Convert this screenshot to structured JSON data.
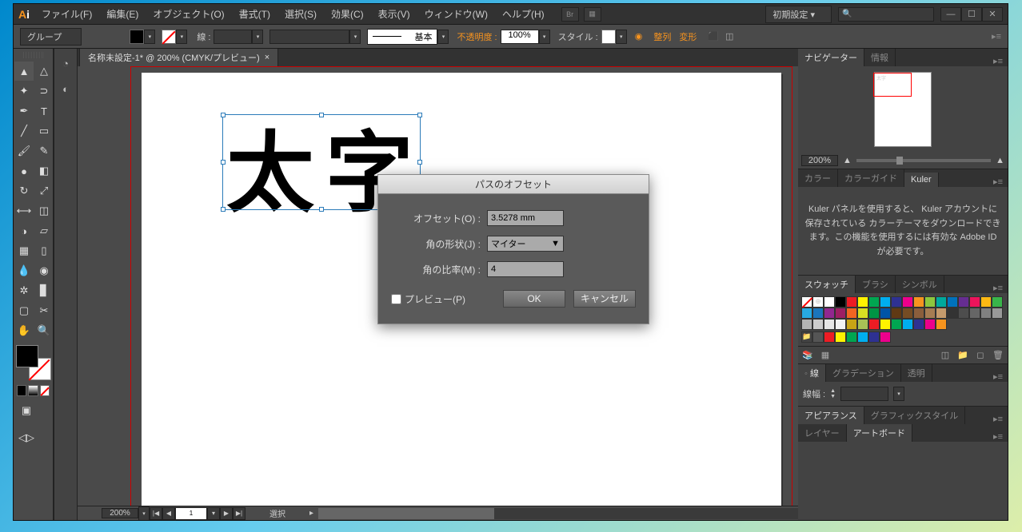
{
  "app_logo": "Ai",
  "menu": [
    "ファイル(F)",
    "編集(E)",
    "オブジェクト(O)",
    "書式(T)",
    "選択(S)",
    "効果(C)",
    "表示(V)",
    "ウィンドウ(W)",
    "ヘルプ(H)"
  ],
  "workspace": "初期設定",
  "control": {
    "selection_label": "グループ",
    "stroke_label": "線 :",
    "style_label": "基本",
    "opacity_label": "不透明度 :",
    "opacity_value": "100%",
    "style2_label": "スタイル :",
    "align_label": "整列",
    "transform_label": "変形"
  },
  "doc_tab": "名称未設定-1* @ 200% (CMYK/プレビュー)",
  "canvas_text": "太字",
  "doc_status": {
    "zoom": "200%",
    "page": "1",
    "mode": "選択"
  },
  "panels": {
    "navigator": {
      "tabs": [
        "ナビゲーター",
        "情報"
      ],
      "zoom": "200%",
      "thumb_text": "太字"
    },
    "color": {
      "tabs": [
        "カラー",
        "カラーガイド",
        "Kuler"
      ],
      "kuler_msg": "Kuler パネルを使用すると、\nKuler アカウントに保存されている\nカラーテーマをダウンロードできます。この機能を使用するには有効な Adobe ID が必要です。"
    },
    "swatches": {
      "tabs": [
        "スウォッチ",
        "ブラシ",
        "シンボル"
      ]
    },
    "stroke": {
      "tabs": [
        "線",
        "グラデーション",
        "透明"
      ],
      "label": "線幅 :"
    },
    "appearance": {
      "tabs": [
        "アピアランス",
        "グラフィックスタイル"
      ]
    },
    "layers": {
      "tabs": [
        "レイヤー",
        "アートボード"
      ]
    }
  },
  "dialog": {
    "title": "パスのオフセット",
    "offset_label": "オフセット(O) :",
    "offset_value": "3.5278 mm",
    "join_label": "角の形状(J) :",
    "join_value": "マイター",
    "miter_label": "角の比率(M) :",
    "miter_value": "4",
    "preview_label": "プレビュー(P)",
    "ok": "OK",
    "cancel": "キャンセル"
  },
  "swatch_colors": [
    "#ffffff",
    "#000000",
    "#ed1c24",
    "#fff200",
    "#00a651",
    "#00aeef",
    "#2e3192",
    "#ec008c",
    "#f7941e",
    "#8dc63e",
    "#00a99d",
    "#0072bc",
    "#662d91",
    "#ed145b",
    "#fdb913",
    "#39b54a",
    "#27aae1",
    "#1b75bb",
    "#92278f",
    "#9e1f63",
    "#f26522",
    "#d7df23",
    "#009444",
    "#0054a6",
    "#603913",
    "#754c24",
    "#8b5e3c",
    "#a67c52",
    "#c49a6c",
    "#333333",
    "#4d4d4d",
    "#666666",
    "#808080",
    "#999999",
    "#b3b3b3",
    "#cccccc",
    "#e6e6e6",
    "#f2f2f2",
    "#c8a415",
    "#a8c256",
    "#ed1c24",
    "#fff200",
    "#00a651",
    "#00aeef",
    "#2e3192",
    "#ec008c",
    "#f7941e"
  ]
}
